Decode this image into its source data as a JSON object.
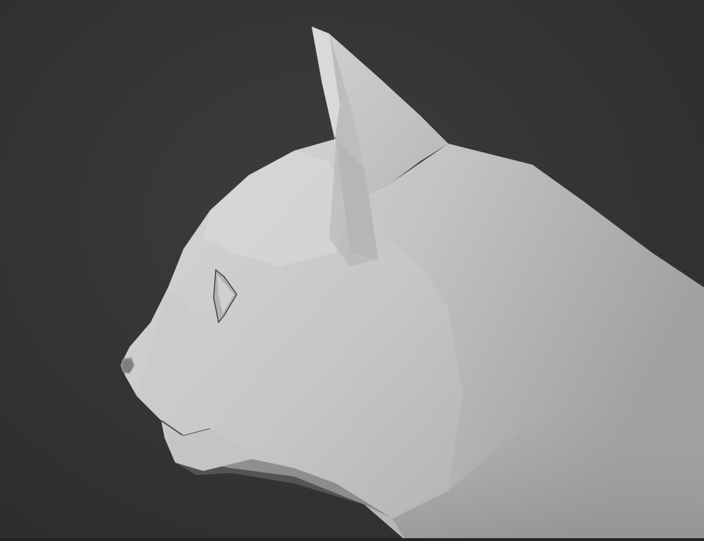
{
  "viewport": {
    "mode": "3d-viewport",
    "shading": "solid",
    "background_color": "#333333",
    "model_color": "#c4c5c7",
    "subject": "cat-head-low-poly-model"
  }
}
